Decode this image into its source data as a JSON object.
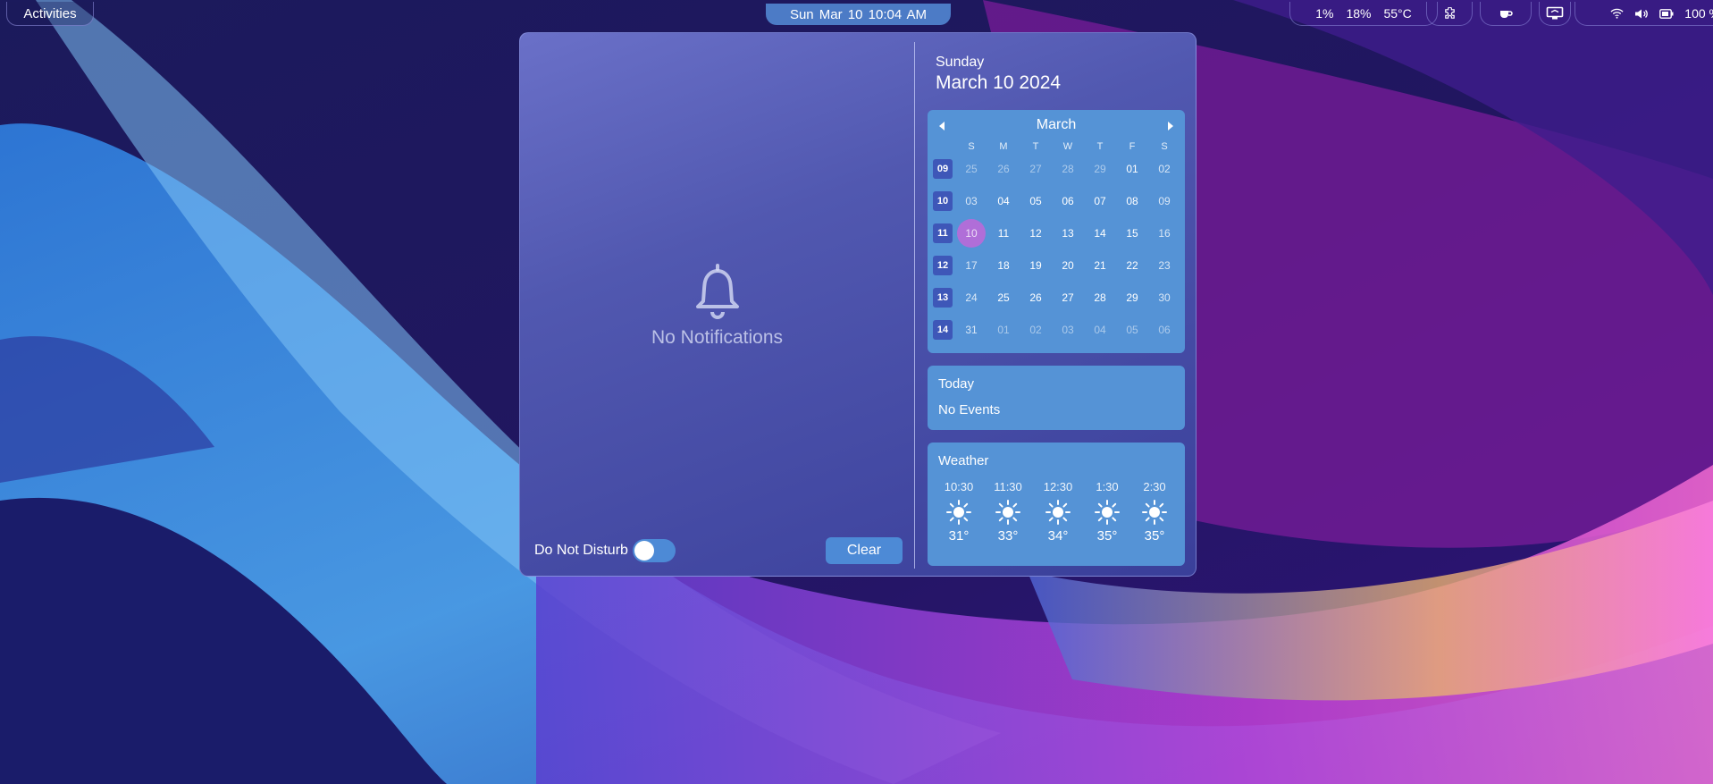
{
  "topbar": {
    "activities_label": "Activities",
    "clock_text": "Sun Mar 10  10:04 AM",
    "stats": [
      "1%",
      "18%",
      "55°C"
    ],
    "battery_text": "100 %"
  },
  "notifications": {
    "empty_text": "No Notifications",
    "dnd_label": "Do Not Disturb",
    "dnd_enabled": false,
    "clear_label": "Clear"
  },
  "calendar": {
    "day_name": "Sunday",
    "date_full": "March 10 2024",
    "month_label": "March",
    "weekdays": [
      "S",
      "M",
      "T",
      "W",
      "T",
      "F",
      "S"
    ],
    "weeks": [
      {
        "num": "09",
        "days": [
          "25",
          "26",
          "27",
          "28",
          "29",
          "01",
          "02"
        ]
      },
      {
        "num": "10",
        "days": [
          "03",
          "04",
          "05",
          "06",
          "07",
          "08",
          "09"
        ]
      },
      {
        "num": "11",
        "days": [
          "10",
          "11",
          "12",
          "13",
          "14",
          "15",
          "16"
        ]
      },
      {
        "num": "12",
        "days": [
          "17",
          "18",
          "19",
          "20",
          "21",
          "22",
          "23"
        ]
      },
      {
        "num": "13",
        "days": [
          "24",
          "25",
          "26",
          "27",
          "28",
          "29",
          "30"
        ]
      },
      {
        "num": "14",
        "days": [
          "31",
          "01",
          "02",
          "03",
          "04",
          "05",
          "06"
        ]
      }
    ],
    "today_marker": "10",
    "accent_color": "#b06ed8"
  },
  "events": {
    "title": "Today",
    "empty_text": "No Events"
  },
  "weather": {
    "title": "Weather",
    "forecast": [
      {
        "time": "10:30",
        "temp": "31°",
        "icon": "sun-icon"
      },
      {
        "time": "11:30",
        "temp": "33°",
        "icon": "sun-icon"
      },
      {
        "time": "12:30",
        "temp": "34°",
        "icon": "sun-icon"
      },
      {
        "time": "1:30",
        "temp": "35°",
        "icon": "sun-icon"
      },
      {
        "time": "2:30",
        "temp": "35°",
        "icon": "sun-icon"
      }
    ]
  }
}
